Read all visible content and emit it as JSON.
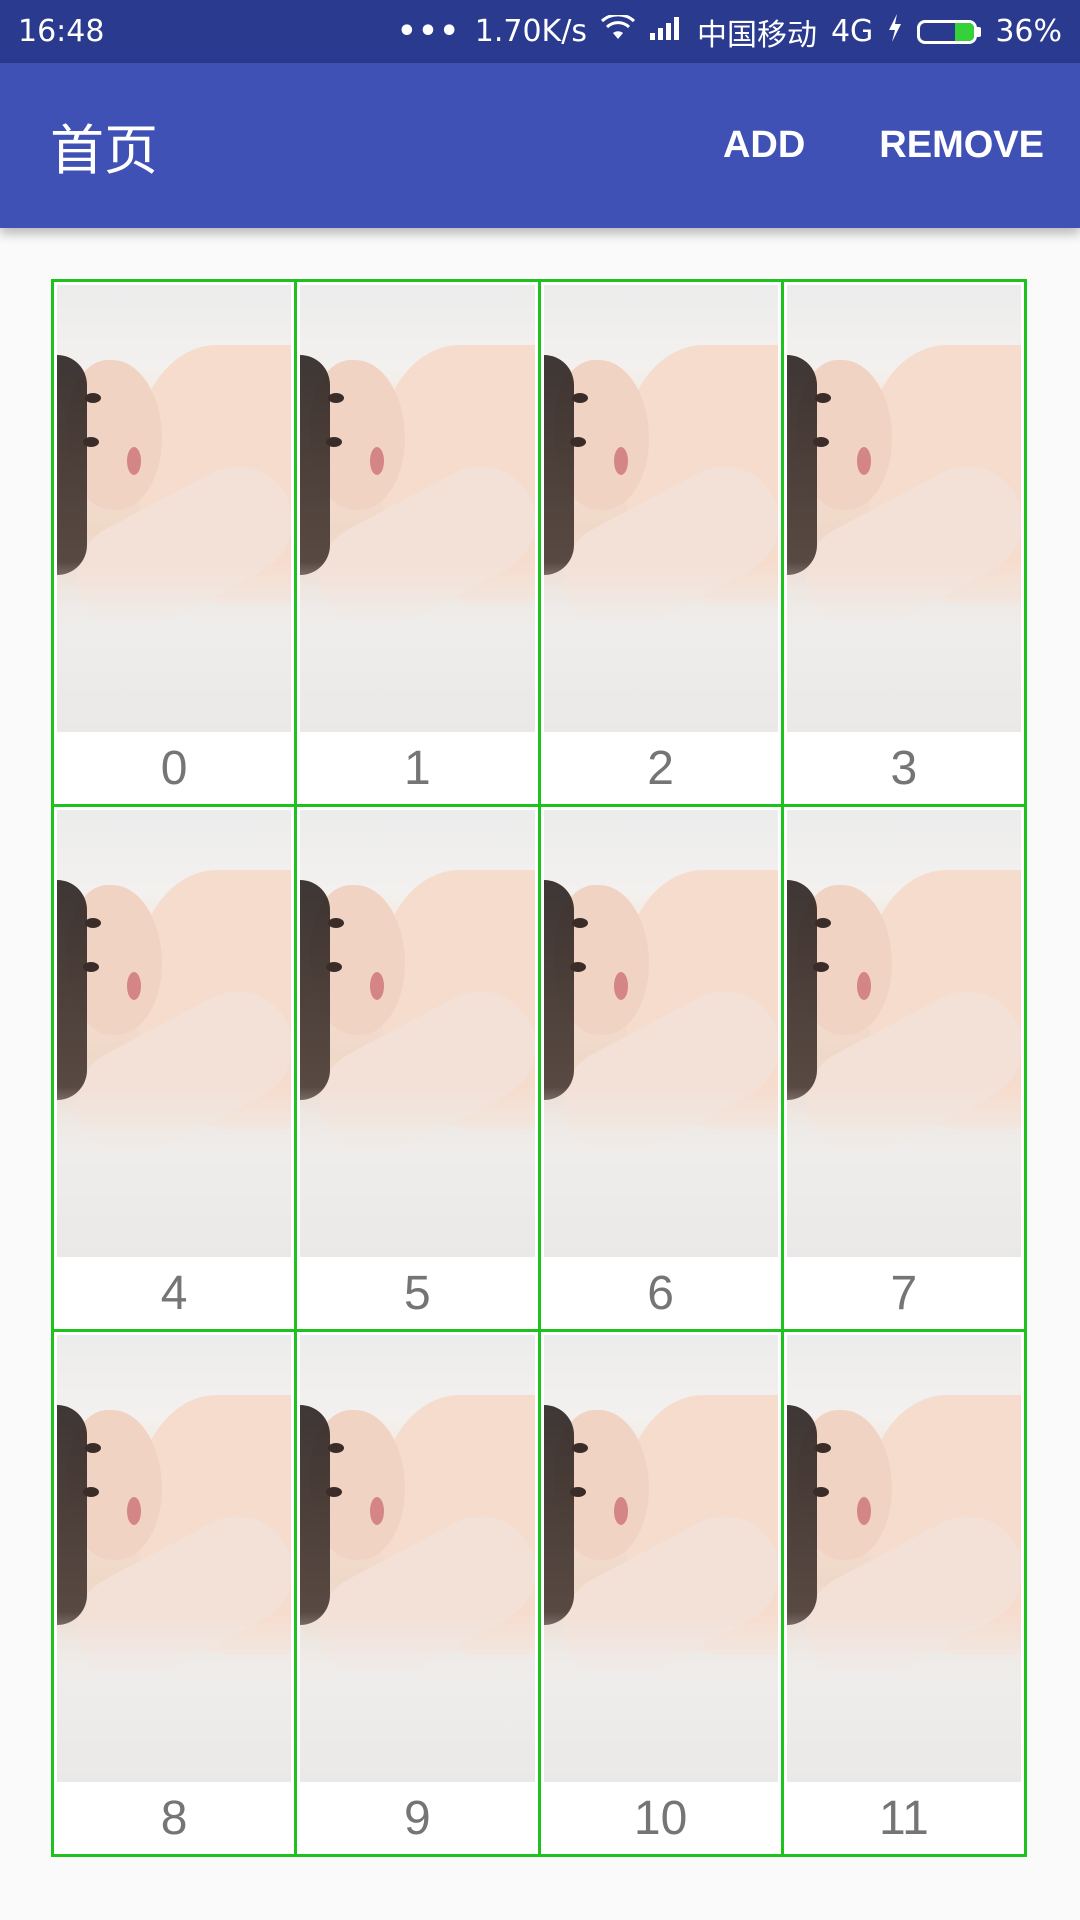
{
  "status_bar": {
    "time": "16:48",
    "dots": "•••",
    "speed": "1.70K/s",
    "carrier": "中国移动",
    "network": "4G",
    "battery_text": "36%",
    "battery_level": 0.36,
    "wifi_icon": "wifi-icon",
    "signal_icon": "signal-bars-icon",
    "charging_icon": "lightning-icon"
  },
  "app_bar": {
    "title": "首页",
    "actions": {
      "add": "ADD",
      "remove": "REMOVE"
    }
  },
  "grid": {
    "border_color": "#1ec21e",
    "items": [
      {
        "label": "0"
      },
      {
        "label": "1"
      },
      {
        "label": "2"
      },
      {
        "label": "3"
      },
      {
        "label": "4"
      },
      {
        "label": "5"
      },
      {
        "label": "6"
      },
      {
        "label": "7"
      },
      {
        "label": "8"
      },
      {
        "label": "9"
      },
      {
        "label": "10"
      },
      {
        "label": "11"
      }
    ]
  },
  "colors": {
    "status_bar": "#2a3a8e",
    "primary": "#3f51b5",
    "label_text": "#757575",
    "battery_fill": "#35d13a"
  }
}
